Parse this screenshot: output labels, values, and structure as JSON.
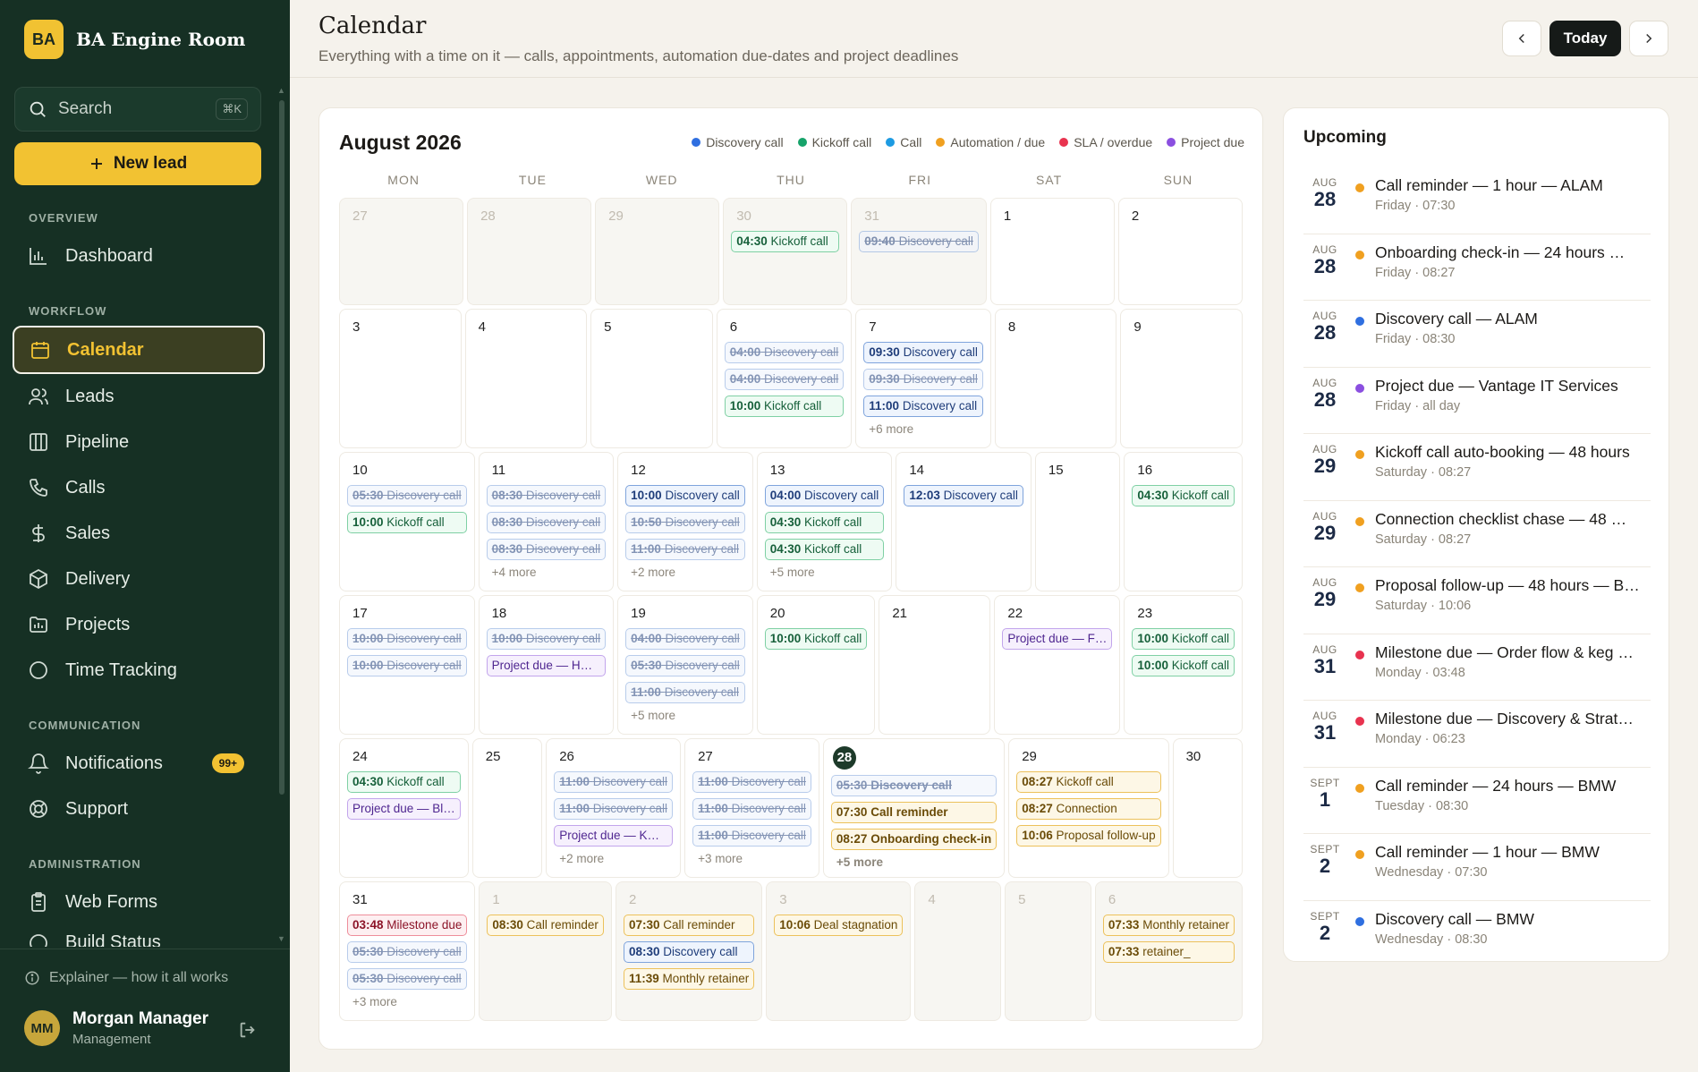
{
  "brand": {
    "logo": "BA",
    "name": "BA Engine Room"
  },
  "search": {
    "placeholder": "Search",
    "shortcut": "⌘K"
  },
  "new_lead": {
    "label": "New lead",
    "icon": "plus-icon"
  },
  "sidebar": {
    "sections": {
      "overview": "OVERVIEW",
      "workflow": "WORKFLOW",
      "communication": "COMMUNICATION",
      "administration": "ADMINISTRATION"
    },
    "items": [
      {
        "label": "Dashboard",
        "icon": "bar-chart-icon"
      },
      {
        "label": "Calendar",
        "icon": "calendar-icon",
        "active": true
      },
      {
        "label": "Leads",
        "icon": "users-icon"
      },
      {
        "label": "Pipeline",
        "icon": "columns-icon"
      },
      {
        "label": "Calls",
        "icon": "phone-icon"
      },
      {
        "label": "Sales",
        "icon": "dollar-icon"
      },
      {
        "label": "Delivery",
        "icon": "package-icon"
      },
      {
        "label": "Projects",
        "icon": "folder-chart-icon"
      },
      {
        "label": "Time Tracking",
        "icon": "clock-circle-icon"
      },
      {
        "label": "Notifications",
        "icon": "bell-icon",
        "badge": "99+"
      },
      {
        "label": "Support",
        "icon": "life-buoy-icon"
      },
      {
        "label": "Web Forms",
        "icon": "clipboard-icon"
      },
      {
        "label": "Build Status",
        "icon": "status-icon"
      }
    ],
    "explainer": "Explainer — how it all works",
    "user": {
      "initials": "MM",
      "name": "Morgan Manager",
      "role": "Management"
    }
  },
  "header": {
    "title": "Calendar",
    "subtitle": "Everything with a time on it — calls, appointments, automation due-dates and project deadlines",
    "today_label": "Today"
  },
  "colors": {
    "discovery": "#2f6fe0",
    "kickoff": "#16a36a",
    "call": "#1d9be2",
    "auto": "#f0a020",
    "sla": "#e8334f",
    "project": "#8b4fe0",
    "sidebar": "#163024",
    "accent": "#f2c232"
  },
  "calendar": {
    "month": "August 2026",
    "legend": [
      {
        "label": "Discovery call",
        "type": "discovery"
      },
      {
        "label": "Kickoff call",
        "type": "kickoff"
      },
      {
        "label": "Call",
        "type": "call"
      },
      {
        "label": "Automation / due",
        "type": "auto"
      },
      {
        "label": "SLA / overdue",
        "type": "sla"
      },
      {
        "label": "Project due",
        "type": "project"
      }
    ],
    "weekdays": [
      "MON",
      "TUE",
      "WED",
      "THU",
      "FRI",
      "SAT",
      "SUN"
    ],
    "weeks": [
      [
        {
          "day": "27",
          "out": true,
          "events": []
        },
        {
          "day": "28",
          "out": true,
          "events": []
        },
        {
          "day": "29",
          "out": true,
          "events": []
        },
        {
          "day": "30",
          "out": true,
          "events": [
            {
              "time": "04:30",
              "title": "Kickoff call",
              "type": "kickoff"
            }
          ]
        },
        {
          "day": "31",
          "out": true,
          "events": [
            {
              "time": "09:40",
              "title": "Discovery call",
              "type": "discovery",
              "done": true
            }
          ]
        },
        {
          "day": "1",
          "events": []
        },
        {
          "day": "2",
          "events": []
        }
      ],
      [
        {
          "day": "3",
          "events": []
        },
        {
          "day": "4",
          "events": []
        },
        {
          "day": "5",
          "events": []
        },
        {
          "day": "6",
          "events": [
            {
              "time": "04:00",
              "title": "Discovery call",
              "type": "discovery",
              "done": true
            },
            {
              "time": "04:00",
              "title": "Discovery call",
              "type": "discovery",
              "done": true
            },
            {
              "time": "10:00",
              "title": "Kickoff call",
              "type": "kickoff"
            }
          ]
        },
        {
          "day": "7",
          "events": [
            {
              "time": "09:30",
              "title": "Discovery call",
              "type": "discovery"
            },
            {
              "time": "09:30",
              "title": "Discovery call",
              "type": "discovery",
              "done": true
            },
            {
              "time": "11:00",
              "title": "Discovery call",
              "type": "discovery"
            }
          ],
          "more": "+6 more"
        },
        {
          "day": "8",
          "events": []
        },
        {
          "day": "9",
          "events": []
        }
      ],
      [
        {
          "day": "10",
          "events": [
            {
              "time": "05:30",
              "title": "Discovery call",
              "type": "discovery",
              "done": true
            },
            {
              "time": "10:00",
              "title": "Kickoff call",
              "type": "kickoff"
            }
          ]
        },
        {
          "day": "11",
          "events": [
            {
              "time": "08:30",
              "title": "Discovery call",
              "type": "discovery",
              "done": true
            },
            {
              "time": "08:30",
              "title": "Discovery call",
              "type": "discovery",
              "done": true
            },
            {
              "time": "08:30",
              "title": "Discovery call",
              "type": "discovery",
              "done": true
            }
          ],
          "more": "+4 more"
        },
        {
          "day": "12",
          "events": [
            {
              "time": "10:00",
              "title": "Discovery call",
              "type": "discovery"
            },
            {
              "time": "10:50",
              "title": "Discovery call",
              "type": "discovery",
              "done": true
            },
            {
              "time": "11:00",
              "title": "Discovery call",
              "type": "discovery",
              "done": true
            }
          ],
          "more": "+2 more"
        },
        {
          "day": "13",
          "events": [
            {
              "time": "04:00",
              "title": "Discovery call",
              "type": "discovery"
            },
            {
              "time": "04:30",
              "title": "Kickoff call",
              "type": "kickoff"
            },
            {
              "time": "04:30",
              "title": "Kickoff call",
              "type": "kickoff"
            }
          ],
          "more": "+5 more"
        },
        {
          "day": "14",
          "events": [
            {
              "time": "12:03",
              "title": "Discovery call",
              "type": "discovery"
            }
          ]
        },
        {
          "day": "15",
          "events": []
        },
        {
          "day": "16",
          "events": [
            {
              "time": "04:30",
              "title": "Kickoff call",
              "type": "kickoff"
            }
          ]
        }
      ],
      [
        {
          "day": "17",
          "events": [
            {
              "time": "10:00",
              "title": "Discovery call",
              "type": "discovery",
              "done": true
            },
            {
              "time": "10:00",
              "title": "Discovery call",
              "type": "discovery",
              "done": true
            }
          ]
        },
        {
          "day": "18",
          "events": [
            {
              "time": "10:00",
              "title": "Discovery call",
              "type": "discovery",
              "done": true
            },
            {
              "time": "",
              "title": "Project due — H…",
              "type": "project"
            }
          ]
        },
        {
          "day": "19",
          "events": [
            {
              "time": "04:00",
              "title": "Discovery call",
              "type": "discovery",
              "done": true
            },
            {
              "time": "05:30",
              "title": "Discovery call",
              "type": "discovery",
              "done": true
            },
            {
              "time": "11:00",
              "title": "Discovery call",
              "type": "discovery",
              "done": true
            }
          ],
          "more": "+5 more"
        },
        {
          "day": "20",
          "events": [
            {
              "time": "10:00",
              "title": "Kickoff call",
              "type": "kickoff"
            }
          ]
        },
        {
          "day": "21",
          "events": []
        },
        {
          "day": "22",
          "events": [
            {
              "time": "",
              "title": "Project due — F…",
              "type": "project"
            }
          ]
        },
        {
          "day": "23",
          "events": [
            {
              "time": "10:00",
              "title": "Kickoff call",
              "type": "kickoff"
            },
            {
              "time": "10:00",
              "title": "Kickoff call",
              "type": "kickoff"
            }
          ]
        }
      ],
      [
        {
          "day": "24",
          "events": [
            {
              "time": "04:30",
              "title": "Kickoff call",
              "type": "kickoff"
            },
            {
              "time": "",
              "title": "Project due — Bl…",
              "type": "project"
            }
          ]
        },
        {
          "day": "25",
          "events": []
        },
        {
          "day": "26",
          "events": [
            {
              "time": "11:00",
              "title": "Discovery call",
              "type": "discovery",
              "done": true
            },
            {
              "time": "11:00",
              "title": "Discovery call",
              "type": "discovery",
              "done": true
            },
            {
              "time": "",
              "title": "Project due — K…",
              "type": "project"
            }
          ],
          "more": "+2 more"
        },
        {
          "day": "27",
          "events": [
            {
              "time": "11:00",
              "title": "Discovery call",
              "type": "discovery",
              "done": true
            },
            {
              "time": "11:00",
              "title": "Discovery call",
              "type": "discovery",
              "done": true
            },
            {
              "time": "11:00",
              "title": "Discovery call",
              "type": "discovery",
              "done": true
            }
          ],
          "more": "+3 more"
        },
        {
          "day": "28",
          "today": true,
          "events": [
            {
              "time": "05:30",
              "title": "Discovery call",
              "type": "discovery",
              "done": true
            },
            {
              "time": "07:30",
              "title": "Call reminder",
              "type": "auto"
            },
            {
              "time": "08:27",
              "title": "Onboarding check-in",
              "type": "auto"
            }
          ],
          "more": "+5 more"
        },
        {
          "day": "29",
          "events": [
            {
              "time": "08:27",
              "title": "Kickoff call",
              "type": "auto"
            },
            {
              "time": "08:27",
              "title": "Connection",
              "type": "auto"
            },
            {
              "time": "10:06",
              "title": "Proposal follow-up",
              "type": "auto"
            }
          ]
        },
        {
          "day": "30",
          "events": []
        }
      ],
      [
        {
          "day": "31",
          "events": [
            {
              "time": "03:48",
              "title": "Milestone due",
              "type": "sla"
            },
            {
              "time": "05:30",
              "title": "Discovery call",
              "type": "discovery",
              "done": true
            },
            {
              "time": "05:30",
              "title": "Discovery call",
              "type": "discovery",
              "done": true
            }
          ],
          "more": "+3 more"
        },
        {
          "day": "1",
          "out": true,
          "events": [
            {
              "time": "08:30",
              "title": "Call reminder",
              "type": "auto"
            }
          ]
        },
        {
          "day": "2",
          "out": true,
          "events": [
            {
              "time": "07:30",
              "title": "Call reminder",
              "type": "auto"
            },
            {
              "time": "08:30",
              "title": "Discovery call",
              "type": "discovery"
            },
            {
              "time": "11:39",
              "title": "Monthly retainer",
              "type": "auto"
            }
          ]
        },
        {
          "day": "3",
          "out": true,
          "events": [
            {
              "time": "10:06",
              "title": "Deal stagnation",
              "type": "auto"
            }
          ]
        },
        {
          "day": "4",
          "out": true,
          "events": []
        },
        {
          "day": "5",
          "out": true,
          "events": []
        },
        {
          "day": "6",
          "out": true,
          "events": [
            {
              "time": "07:33",
              "title": "Monthly retainer",
              "type": "auto"
            },
            {
              "time": "07:33",
              "title": "retainer_",
              "type": "auto"
            }
          ]
        }
      ]
    ]
  },
  "upcoming": {
    "title": "Upcoming",
    "items": [
      {
        "mon": "AUG",
        "day": "28",
        "type": "auto",
        "name": "Call reminder — 1 hour — ALAM",
        "sub": "Friday · 07:30"
      },
      {
        "mon": "AUG",
        "day": "28",
        "type": "auto",
        "name": "Onboarding check-in — 24 hours …",
        "sub": "Friday · 08:27"
      },
      {
        "mon": "AUG",
        "day": "28",
        "type": "discovery",
        "name": "Discovery call — ALAM",
        "sub": "Friday · 08:30"
      },
      {
        "mon": "AUG",
        "day": "28",
        "type": "project",
        "name": "Project due — Vantage IT Services",
        "sub": "Friday · all day"
      },
      {
        "mon": "AUG",
        "day": "29",
        "type": "auto",
        "name": "Kickoff call auto-booking — 48 hours",
        "sub": "Saturday · 08:27"
      },
      {
        "mon": "AUG",
        "day": "29",
        "type": "auto",
        "name": "Connection checklist chase — 48 …",
        "sub": "Saturday · 08:27"
      },
      {
        "mon": "AUG",
        "day": "29",
        "type": "auto",
        "name": "Proposal follow-up — 48 hours — B…",
        "sub": "Saturday · 10:06"
      },
      {
        "mon": "AUG",
        "day": "31",
        "type": "sla",
        "name": "Milestone due — Order flow & keg …",
        "sub": "Monday · 03:48"
      },
      {
        "mon": "AUG",
        "day": "31",
        "type": "sla",
        "name": "Milestone due — Discovery & Strat…",
        "sub": "Monday · 06:23"
      },
      {
        "mon": "SEPT",
        "day": "1",
        "type": "auto",
        "name": "Call reminder — 24 hours — BMW",
        "sub": "Tuesday · 08:30"
      },
      {
        "mon": "SEPT",
        "day": "2",
        "type": "auto",
        "name": "Call reminder — 1 hour — BMW",
        "sub": "Wednesday · 07:30"
      },
      {
        "mon": "SEPT",
        "day": "2",
        "type": "discovery",
        "name": "Discovery call — BMW",
        "sub": "Wednesday · 08:30"
      }
    ]
  }
}
